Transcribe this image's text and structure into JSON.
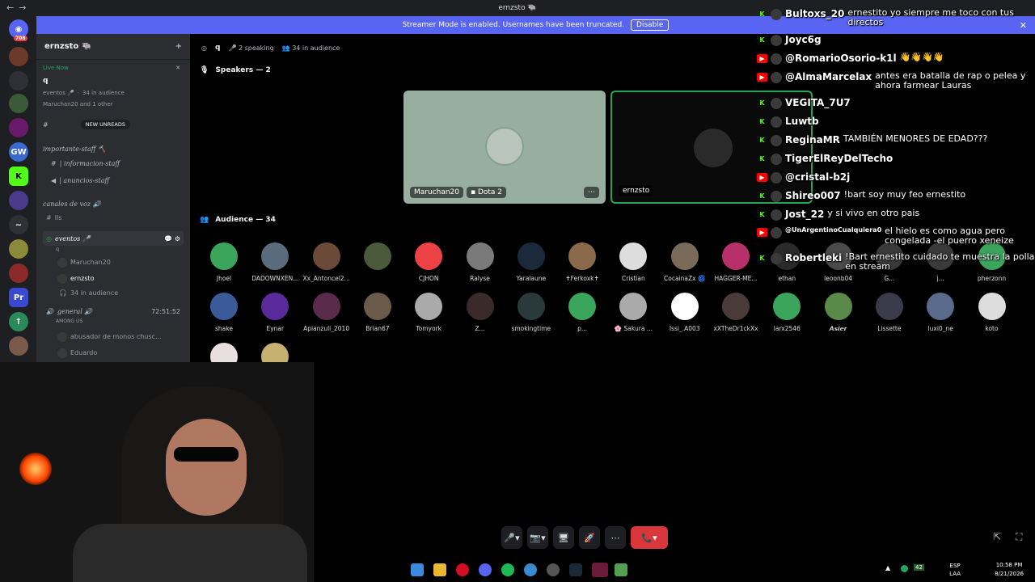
{
  "window": {
    "title": "ernzsto 🐃"
  },
  "banner": {
    "text": "Streamer Mode is enabled. Usernames have been truncated.",
    "button": "Disable"
  },
  "guilds": {
    "badge": "708"
  },
  "server": {
    "name": "ernzsto 🐃",
    "live_now": "Live Now",
    "live_channel": "q",
    "live_event": "eventos 🎤",
    "live_audience": "34 in audience",
    "live_members": "Maruchan20 and 1 other",
    "new_unreads": "NEW UNREADS",
    "section1": "importante-staff 🔨",
    "channels1": [
      "| informacion-staff",
      "| anuncios-staff"
    ],
    "section2": "canales de voz 🔊",
    "channel_text": "Ils",
    "stage": {
      "name": "eventos 🎤",
      "topic": "q",
      "members": [
        "Maruchan20",
        "ernzsto"
      ],
      "audience": "34 in audience"
    },
    "voice": {
      "name": "general 🔊",
      "timer": "72:51:52",
      "among": "AMONG US",
      "members": [
        "abusador de monos chusc...",
        "Eduardo"
      ]
    }
  },
  "stage_bar": {
    "title": "q",
    "speaking": "2 speaking",
    "audience": "34 in audience"
  },
  "speakers": {
    "header": "Speakers — 2",
    "tiles": [
      {
        "name": "Maruchan20",
        "activity": "Dota 2"
      },
      {
        "name": "ernzsto"
      }
    ]
  },
  "audience": {
    "header": "Audience — 34",
    "names": [
      "Jhoel",
      "DADOWNXEN...",
      "Xx_Antoncel2...",
      "",
      "CJHON",
      "Ralyse",
      "Yaralaune",
      "✝Ferkoxk✝",
      "Cristian",
      "CocainaZx 🌀",
      "HAGGER-ME...",
      "ethan",
      "leoonb04",
      "G...",
      "j...",
      "pherzonn",
      "shake",
      "Eynar",
      "Apianzuli_2010",
      "Brian67",
      "Tomyork",
      "Z...",
      "smokingtime",
      "p...",
      "🌸 Sakura ...",
      "Issi_.A003",
      "xXTheDr1ckXx",
      "larx2546",
      "𝘼𝙨𝙞𝙚𝙧",
      "Lissette",
      "luxi0_ne",
      "koto",
      "",
      ""
    ],
    "colors": [
      "#3ba55c",
      "#5a6b7d",
      "#6b4a3a",
      "#4a5a3a",
      "#ed4245",
      "#7a7a7a",
      "#1a2a3a",
      "#8a6a4a",
      "#dddddd",
      "#7a6a5a",
      "#b8306a",
      "#2a2a2a",
      "#4a4a4a",
      "#3a3a3a",
      "#3a3a3a",
      "#3ba55c",
      "#3a5a9a",
      "#5a2a9a",
      "#5a2a4a",
      "#6a5a4a",
      "#aaaaaa",
      "#3a2a2a",
      "#2a3a3a",
      "#3ba55c",
      "#aaaaaa",
      "#ffffff",
      "#4a3a3a",
      "#3ba55c",
      "#5a8a4a",
      "#3a3a4a",
      "#5a6a8a",
      "#dddddd",
      "#e8e0e0",
      "#c8b070"
    ]
  },
  "controls": {
    "mic": "🎤",
    "cam": "📷",
    "share": "🖥",
    "activity": "🚀",
    "more": "⋯",
    "leave": "📞"
  },
  "chat": [
    {
      "platform": "kick",
      "user": "Bultoxs_20",
      "msg": "ernestito yo siempre me toco con tus directos"
    },
    {
      "platform": "kick",
      "user": "Joyc6g",
      "msg": ""
    },
    {
      "platform": "yt",
      "user": "@RomarioOsorio-k1l",
      "msg": "👋👋👋👋"
    },
    {
      "platform": "yt",
      "user": "@AlmaMarcelax",
      "msg": "antes era batalla de rap o pelea y ahora farmear Lauras"
    },
    {
      "platform": "kick",
      "user": "VEGITA_7U7",
      "msg": ""
    },
    {
      "platform": "kick",
      "user": "Luwtb",
      "msg": ""
    },
    {
      "platform": "kick",
      "user": "ReginaMR",
      "msg": "TAMBIÉN MENORES DE EDAD???"
    },
    {
      "platform": "kick",
      "user": "TigerElReyDelTecho",
      "msg": ""
    },
    {
      "platform": "yt",
      "user": "@cristal-b2j",
      "msg": ""
    },
    {
      "platform": "kick",
      "user": "Shireo007",
      "msg": "!bart soy muy feo ernestito"
    },
    {
      "platform": "kick",
      "user": "Jost_22",
      "msg": "y si vivo en otro pais"
    },
    {
      "platform": "yt",
      "user": "@UnArgentinoCualquiera0",
      "msg": "el hielo es como agua pero congelada -el puerro xeneize"
    },
    {
      "platform": "kick",
      "user": "Robertleki",
      "msg": "!Bart ernestito cuidado te muestra la polla en stream"
    }
  ],
  "tray": {
    "lang1": "ESP",
    "lang2": "LAA",
    "time": "10:58 PM",
    "date": "8/21/2026",
    "num": "42"
  }
}
